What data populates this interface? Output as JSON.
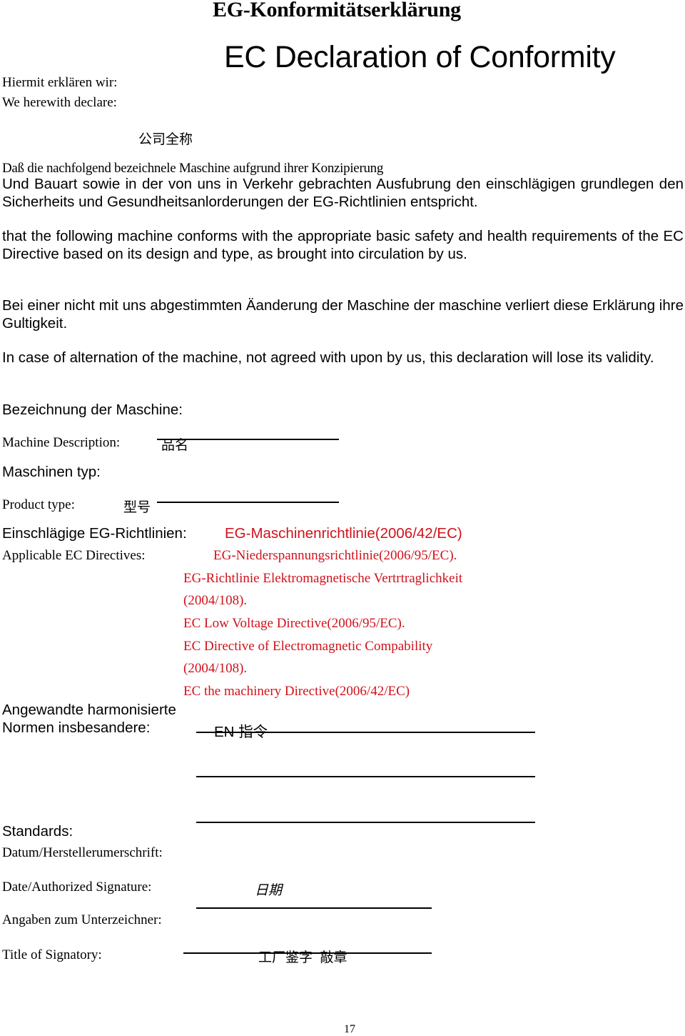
{
  "header": {
    "title_de": "EG-Konformitätserklärung",
    "title_en": "EC Declaration of Conformity"
  },
  "declaration": {
    "label_de": "Hiermit erklären wir:",
    "label_en": "We herewith declare:",
    "company_placeholder": "公司全称"
  },
  "body": {
    "dass_line": "Daß die nachfolgend bezeichnele Maschine aufgrund ihrer Konzipierung",
    "paragraph_de_conformity": "Und Bauart sowie in der von uns in Verkehr gebrachten Ausfubrung den einschlägigen grundlegen den Sicherheits und Gesundheitsanlorderungen der EG-Richtlinien entspricht.",
    "paragraph_en_conformity": "that the following machine conforms with the appropriate basic safety and health requirements of the EC Directive based on its design and type, as brought into circulation by us.",
    "paragraph_de_alteration": "Bei einer nicht mit uns abgestimmten Äanderung der Maschine der maschine verliert diese Erklärung ihre Gultigkeit.",
    "paragraph_en_alteration": "In case of alternation of the machine, not agreed with upon by us, this declaration will lose its validity."
  },
  "machine": {
    "bezeichnung_label": "Bezeichnung der Maschine:",
    "description_label": "Machine Description:",
    "description_value": "品名",
    "typ_label": "Maschinen typ:",
    "product_type_label": "Product type:",
    "product_type_value": "型号"
  },
  "directives": {
    "label_de": "Einschlägige EG-Richtlinien:",
    "label_en": "Applicable EC Directives:",
    "accent_color": "#d0121b",
    "items": [
      "EG-Maschinenrichtlinie(2006/42/EC)",
      "EG-Niederspannungsrichtlinie(2006/95/EC).",
      "EG-Richtlinie Elektromagnetische Vertrtraglichkeit",
      "(2004/108).",
      "EC Low Voltage Directive(2006/95/EC).",
      "EC Directive of Electromagnetic Compability",
      "(2004/108).",
      "EC the machinery Directive(2006/42/EC)"
    ]
  },
  "standards": {
    "label_de_line1": "Angewandte harmonisierte",
    "label_de_line2": "Normen insbesandere:",
    "value": "EN 指令",
    "label_en": "Standards:"
  },
  "signature": {
    "datum_label": "Datum/Herstellerumerschrift:",
    "date_label": "Date/Authorized Signature:",
    "date_value": "日期",
    "unterzeichner_label": "Angaben zum Unterzeichner:",
    "title_label": "Title of Signatory:",
    "title_value": "工厂鉴字  敲章"
  },
  "footer": {
    "page_number": "17"
  }
}
